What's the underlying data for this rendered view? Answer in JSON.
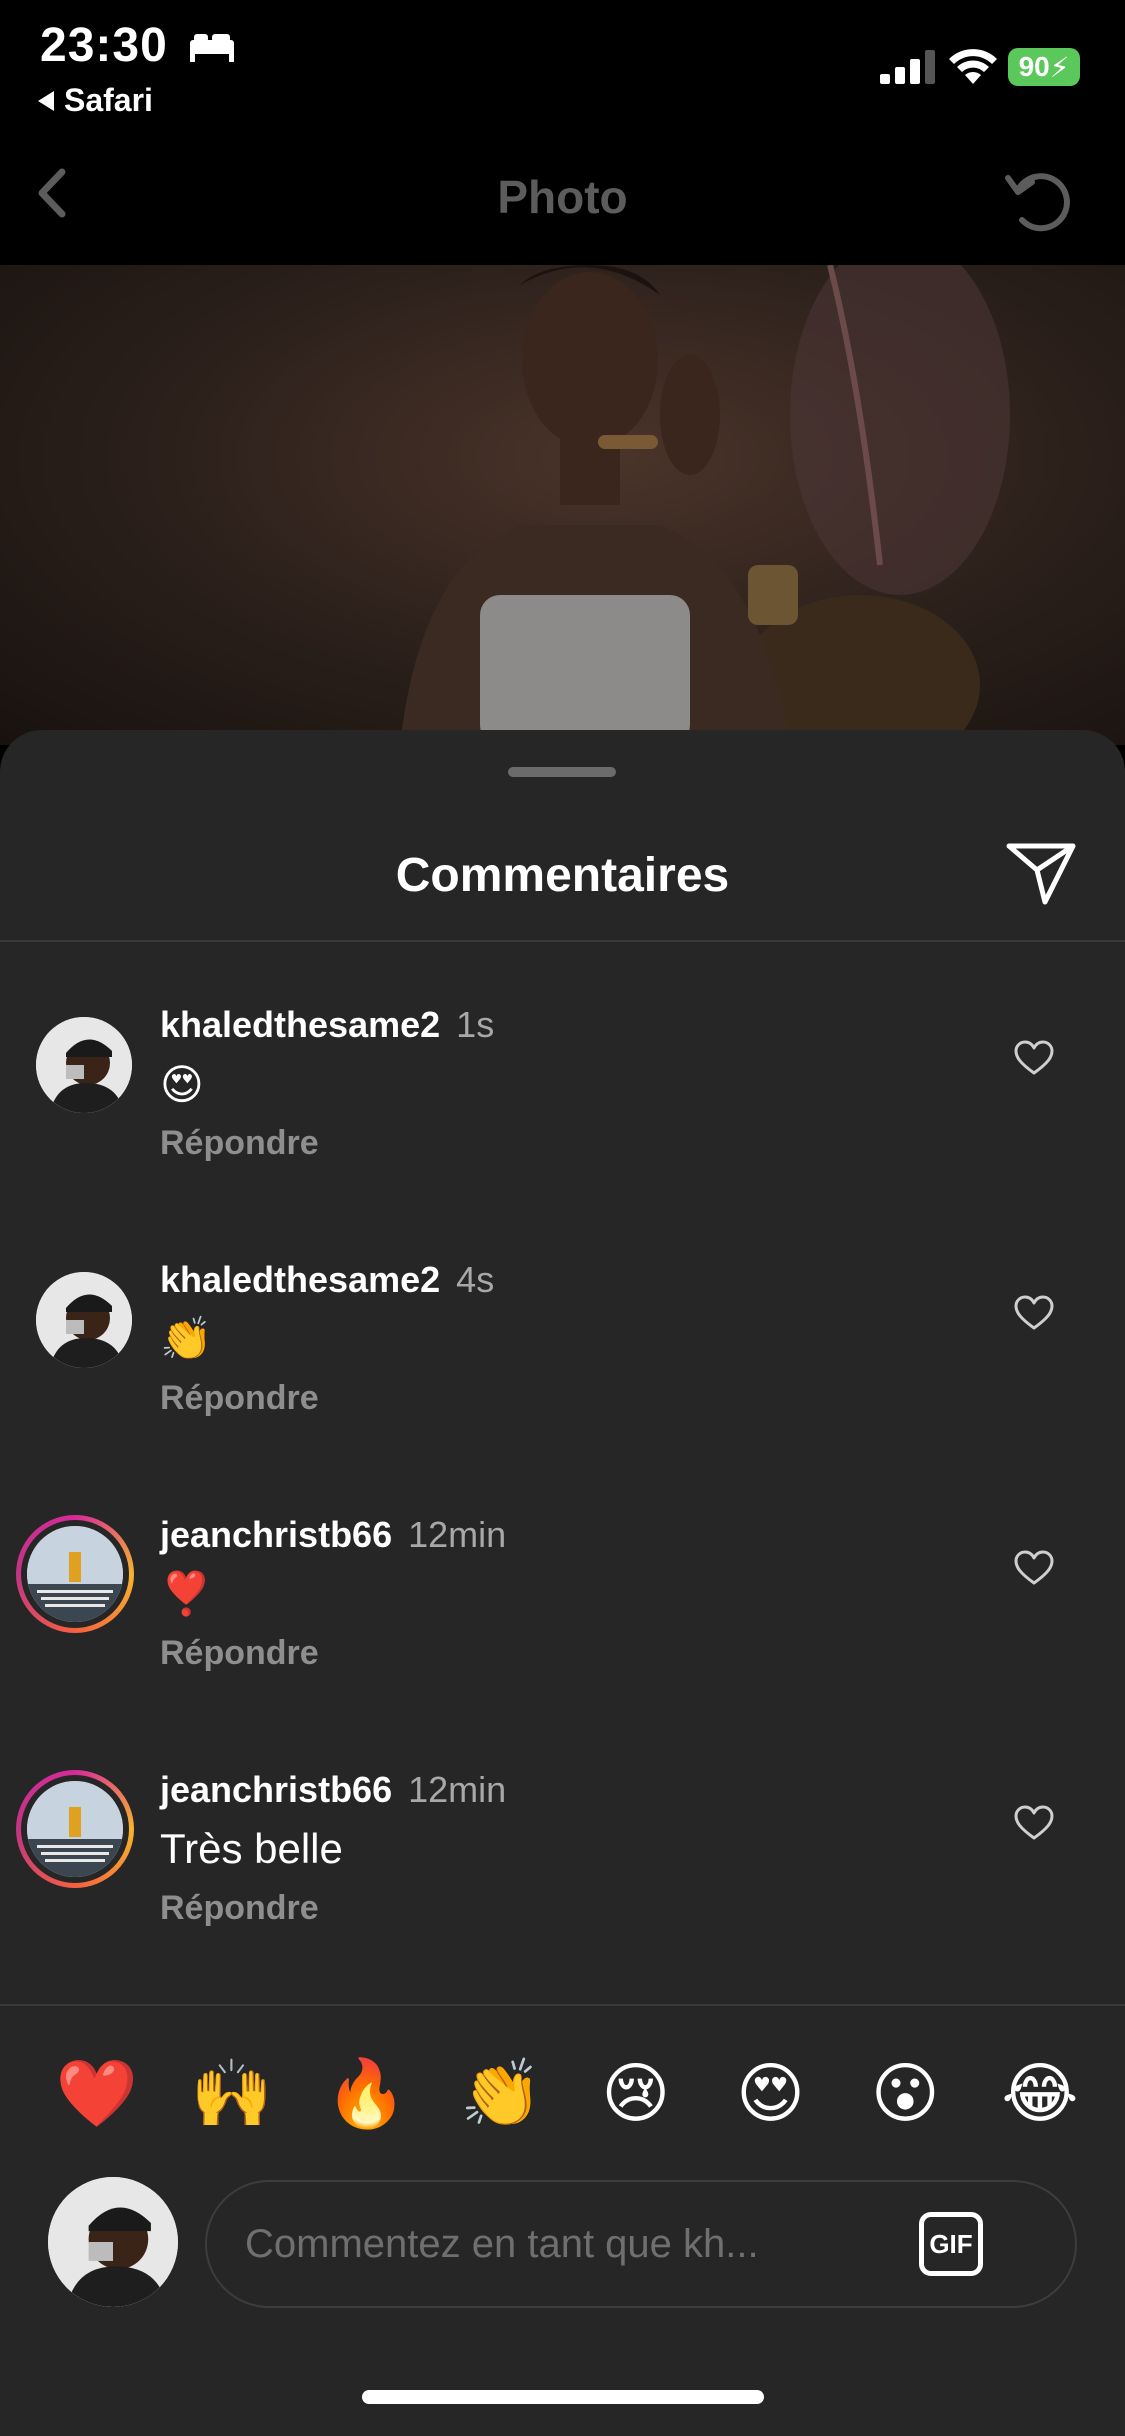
{
  "status_bar": {
    "time": "23:30",
    "back_app": "Safari",
    "battery": "90"
  },
  "nav": {
    "title": "Photo"
  },
  "sheet": {
    "title": "Commentaires"
  },
  "comments": [
    {
      "user": "khaledthesame2",
      "time": "1s",
      "text": "😍",
      "reply": "Répondre",
      "avatar_ring": false
    },
    {
      "user": "khaledthesame2",
      "time": "4s",
      "text": "👏",
      "reply": "Répondre",
      "avatar_ring": false
    },
    {
      "user": "jeanchristb66",
      "time": "12min",
      "text": "❣️",
      "reply": "Répondre",
      "avatar_ring": true
    },
    {
      "user": "jeanchristb66",
      "time": "12min",
      "text": "Très belle",
      "reply": "Répondre",
      "avatar_ring": true
    }
  ],
  "quick_emojis": [
    "❤️",
    "🙌",
    "🔥",
    "👏",
    "😢",
    "😍",
    "😮",
    "😂"
  ],
  "composer": {
    "placeholder": "Commentez en tant que kh...",
    "gif_label": "GIF"
  },
  "colors": {
    "background": "#000000",
    "sheet": "#262626",
    "secondary_text": "#8e8e8e",
    "battery": "#5ac85a"
  }
}
